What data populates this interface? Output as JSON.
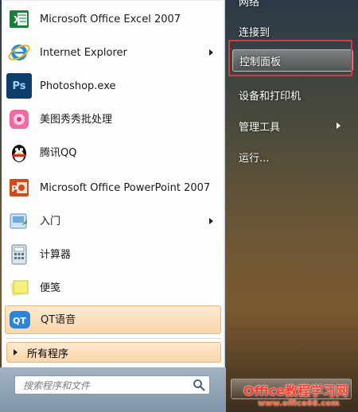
{
  "left": {
    "items": [
      {
        "label": "Microsoft Office Excel 2007",
        "icon": "excel-icon",
        "arrow": false
      },
      {
        "label": "Internet Explorer",
        "icon": "ie-icon",
        "arrow": true
      },
      {
        "label": "Photoshop.exe",
        "icon": "photoshop-icon",
        "arrow": false
      },
      {
        "label": "美图秀秀批处理",
        "icon": "meitu-icon",
        "arrow": false
      },
      {
        "label": "腾讯QQ",
        "icon": "qq-penguin-icon",
        "arrow": false
      },
      {
        "label": "Microsoft Office PowerPoint 2007",
        "icon": "powerpoint-icon",
        "arrow": false
      },
      {
        "label": "入门",
        "icon": "getting-started-icon",
        "arrow": true
      },
      {
        "label": "计算器",
        "icon": "calculator-icon",
        "arrow": false
      },
      {
        "label": "便笺",
        "icon": "sticky-notes-icon",
        "arrow": false
      },
      {
        "label": "QT语音",
        "icon": "qt-voice-icon",
        "arrow": false,
        "highlighted": true
      }
    ],
    "all_programs": "所有程序"
  },
  "search": {
    "placeholder": "搜索程序和文件"
  },
  "right": {
    "items": [
      {
        "label": "网络",
        "arrow": false
      },
      {
        "label": "连接到",
        "arrow": false
      },
      {
        "label": "控制面板",
        "arrow": false,
        "selected": true
      },
      {
        "label": "设备和打印机",
        "arrow": false
      },
      {
        "label": "管理工具",
        "arrow": true
      },
      {
        "label": "运行...",
        "arrow": false
      }
    ]
  },
  "watermark": {
    "line1": "Office教程学习网",
    "line2": "www.office68.com"
  },
  "colors": {
    "highlight": "#fbd6a9",
    "annotation_red": "#d23c3c"
  }
}
